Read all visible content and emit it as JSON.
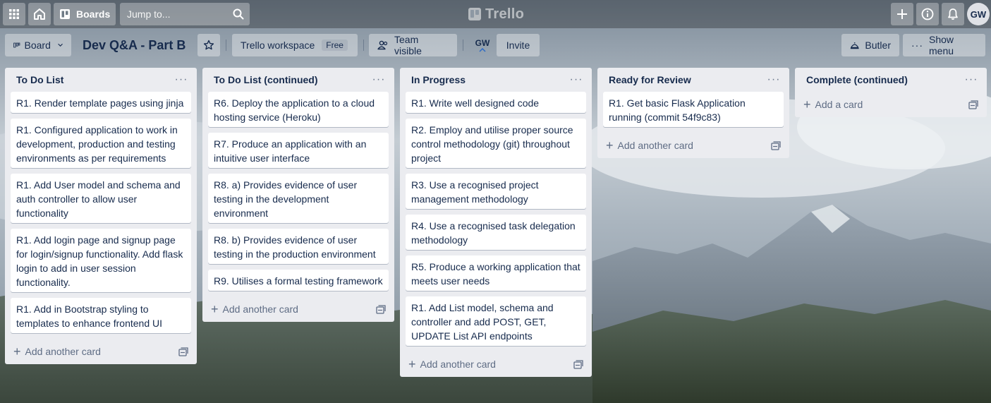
{
  "topbar": {
    "apps_icon": "grid-icon",
    "home_icon": "home-icon",
    "boards_label": "Boards",
    "search_placeholder": "Jump to...",
    "logo_text": "Trello",
    "avatar_initials": "GW"
  },
  "board": {
    "view_label": "Board",
    "title": "Dev Q&A - Part B",
    "workspace_label": "Trello workspace",
    "workspace_badge": "Free",
    "visibility_label": "Team visible",
    "member_initials": "GW",
    "invite_label": "Invite",
    "butler_label": "Butler",
    "menu_label": "Show menu"
  },
  "lists": [
    {
      "title": "To Do List",
      "cards": [
        "R1. Render template pages using jinja",
        "R1. Configured application to work in development, production and testing environments as per requirements",
        "R1. Add User model and schema and auth controller to allow user functionality",
        "R1. Add login page and signup page for login/signup functionality. Add flask login to add in user session functionality.",
        "R1. Add in Bootstrap styling to templates to enhance frontend UI"
      ],
      "add_label": "Add another card"
    },
    {
      "title": "To Do List (continued)",
      "cards": [
        "R6. Deploy the application to a cloud hosting service (Heroku)",
        "R7. Produce an application with an intuitive user interface",
        "R8. a) Provides evidence of user testing in the development environment",
        "R8. b) Provides evidence of user testing in the production environment",
        "R9. Utilises a formal testing framework"
      ],
      "add_label": "Add another card"
    },
    {
      "title": "In Progress",
      "cards": [
        "R1. Write well designed code",
        "R2. Employ and utilise proper source control methodology (git) throughout project",
        "R3. Use a recognised project management methodology",
        "R4. Use a recognised task delegation methodology",
        "R5. Produce a working application that meets user needs",
        "R1. Add List model, schema and controller and add POST, GET, UPDATE List API endpoints"
      ],
      "add_label": "Add another card"
    },
    {
      "title": "Ready for Review",
      "cards": [
        "R1. Get basic Flask Application running (commit 54f9c83)"
      ],
      "add_label": "Add another card"
    },
    {
      "title": "Complete (continued)",
      "cards": [],
      "add_label": "Add a card"
    }
  ]
}
